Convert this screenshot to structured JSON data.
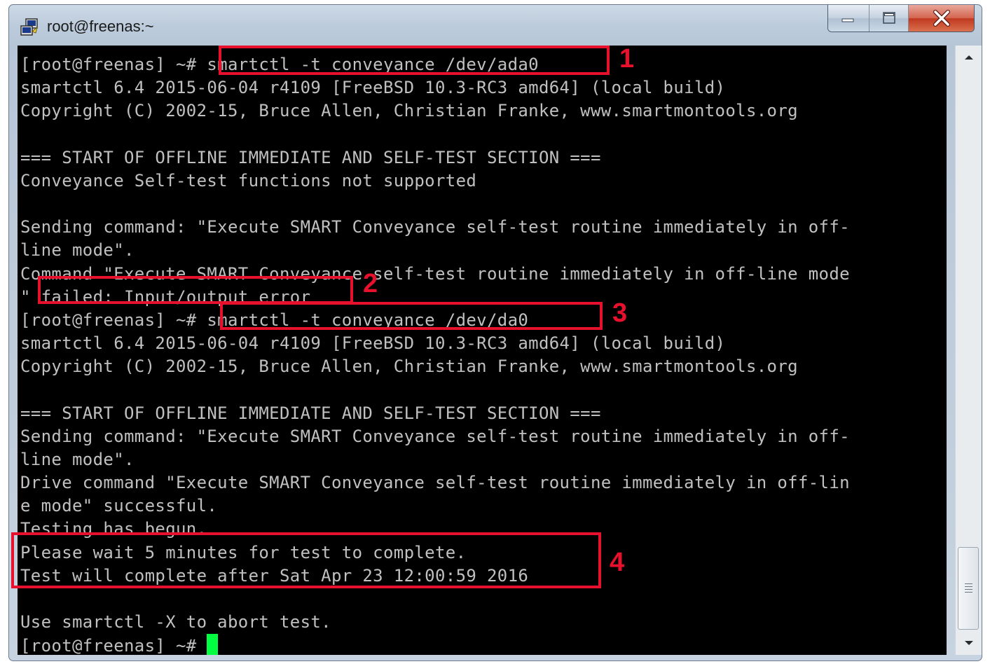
{
  "window": {
    "title": "root@freenas:~",
    "controls": {
      "minimize": "minimize",
      "maximize": "maximize",
      "close": "close"
    }
  },
  "terminal": {
    "lines": [
      "[root@freenas] ~# smartctl -t conveyance /dev/ada0",
      "smartctl 6.4 2015-06-04 r4109 [FreeBSD 10.3-RC3 amd64] (local build)",
      "Copyright (C) 2002-15, Bruce Allen, Christian Franke, www.smartmontools.org",
      "",
      "=== START OF OFFLINE IMMEDIATE AND SELF-TEST SECTION ===",
      "Conveyance Self-test functions not supported",
      "",
      "Sending command: \"Execute SMART Conveyance self-test routine immediately in off-",
      "line mode\".",
      "Command \"Execute SMART Conveyance self-test routine immediately in off-line mode",
      "\" failed: Input/output error",
      "[root@freenas] ~# smartctl -t conveyance /dev/da0",
      "smartctl 6.4 2015-06-04 r4109 [FreeBSD 10.3-RC3 amd64] (local build)",
      "Copyright (C) 2002-15, Bruce Allen, Christian Franke, www.smartmontools.org",
      "",
      "=== START OF OFFLINE IMMEDIATE AND SELF-TEST SECTION ===",
      "Sending command: \"Execute SMART Conveyance self-test routine immediately in off-",
      "line mode\".",
      "Drive command \"Execute SMART Conveyance self-test routine immediately in off-lin",
      "e mode\" successful.",
      "Testing has begun.",
      "Please wait 5 minutes for test to complete.",
      "Test will complete after Sat Apr 23 12:00:59 2016",
      "",
      "Use smartctl -X to abort test.",
      "[root@freenas] ~# "
    ]
  },
  "annotations": [
    {
      "number": "1"
    },
    {
      "number": "2"
    },
    {
      "number": "3"
    },
    {
      "number": "4"
    }
  ],
  "colors": {
    "terminal_bg": "#000000",
    "terminal_text": "#c0c0c0",
    "cursor": "#00ff40",
    "annotation": "#e8112d"
  }
}
